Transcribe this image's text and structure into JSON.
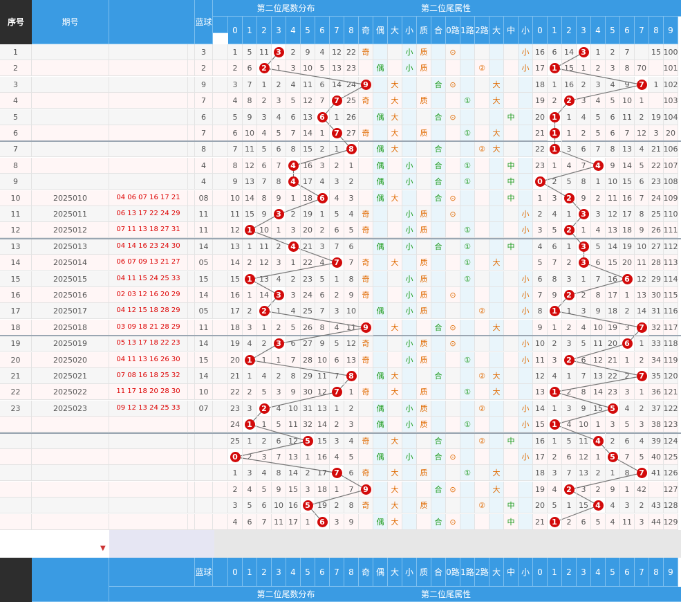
{
  "headers": {
    "seq": "序号",
    "period": "期号",
    "blue_ball": "蓝球",
    "section_digits": "第二位尾数分布",
    "section_attr": "第二位尾属性",
    "digit_labels": [
      "0",
      "1",
      "2",
      "3",
      "4",
      "5",
      "6",
      "7",
      "8",
      "9"
    ],
    "attr_labels": [
      "奇",
      "偶",
      "大",
      "小",
      "质",
      "合",
      "0路",
      "1路",
      "2路",
      "大",
      "中",
      "小"
    ],
    "right_labels": [
      "0",
      "1",
      "2",
      "3",
      "4",
      "5",
      "6",
      "7",
      "8",
      "9"
    ]
  },
  "rows": [
    {
      "seq": "1",
      "period": "",
      "nums": "",
      "blue": "3",
      "digit": 3,
      "miss": [
        "1",
        "5",
        "11",
        "",
        "2",
        "9",
        "4",
        "12",
        "22",
        "3"
      ],
      "oe": "奇",
      "bs": "小",
      "pc": "质",
      "road": "0",
      "size": "小",
      "pos": 3,
      "right": [
        "16",
        "6",
        "14",
        "",
        "1",
        "2",
        "7",
        "",
        "15",
        "100"
      ]
    },
    {
      "seq": "2",
      "period": "",
      "nums": "",
      "blue": "2",
      "digit": 2,
      "miss": [
        "2",
        "6",
        "",
        "1",
        "3",
        "10",
        "5",
        "13",
        "23",
        "4"
      ],
      "oe": "偶",
      "bs": "小",
      "pc": "质",
      "road": "2",
      "size": "小",
      "pos": 1,
      "right": [
        "17",
        "",
        "15",
        "1",
        "2",
        "3",
        "8",
        "70",
        "",
        "101"
      ]
    },
    {
      "seq": "3",
      "period": "",
      "nums": "",
      "blue": "9",
      "digit": 9,
      "miss": [
        "3",
        "7",
        "1",
        "2",
        "4",
        "11",
        "6",
        "14",
        "24",
        ""
      ],
      "oe": "奇",
      "bs": "大",
      "pc": "合",
      "road": "0",
      "size": "大",
      "pos": 7,
      "right": [
        "18",
        "1",
        "16",
        "2",
        "3",
        "4",
        "9",
        "",
        "1",
        "102"
      ]
    },
    {
      "seq": "4",
      "period": "",
      "nums": "",
      "blue": "7",
      "digit": 7,
      "miss": [
        "4",
        "8",
        "2",
        "3",
        "5",
        "12",
        "7",
        "",
        "25",
        "1"
      ],
      "oe": "奇",
      "bs": "大",
      "pc": "质",
      "road": "1",
      "size": "大",
      "pos": 2,
      "right": [
        "19",
        "2",
        "",
        "3",
        "4",
        "5",
        "10",
        "1",
        "",
        "103"
      ]
    },
    {
      "seq": "5",
      "period": "",
      "nums": "",
      "blue": "6",
      "digit": 6,
      "miss": [
        "5",
        "9",
        "3",
        "4",
        "6",
        "13",
        "",
        "1",
        "26",
        "2"
      ],
      "oe": "偶",
      "bs": "大",
      "pc": "合",
      "road": "0",
      "size": "中",
      "pos": 1,
      "right": [
        "20",
        "",
        "1",
        "4",
        "5",
        "6",
        "11",
        "2",
        "19",
        "104"
      ]
    },
    {
      "seq": "6",
      "period": "",
      "nums": "",
      "blue": "7",
      "digit": 7,
      "miss": [
        "6",
        "10",
        "4",
        "5",
        "7",
        "14",
        "1",
        "",
        "27",
        "3"
      ],
      "oe": "奇",
      "bs": "大",
      "pc": "质",
      "road": "1",
      "size": "大",
      "pos": 1,
      "right": [
        "21",
        "",
        "1",
        "2",
        "5",
        "6",
        "7",
        "12",
        "3",
        "20",
        "105"
      ]
    },
    {
      "seq": "7",
      "period": "",
      "nums": "",
      "blue": "8",
      "digit": 8,
      "miss": [
        "7",
        "11",
        "5",
        "6",
        "8",
        "15",
        "2",
        "1",
        "",
        "4"
      ],
      "oe": "偶",
      "bs": "大",
      "pc": "合",
      "road": "2",
      "size": "大",
      "pos": 1,
      "right": [
        "22",
        "",
        "3",
        "6",
        "7",
        "8",
        "13",
        "4",
        "21",
        "106"
      ]
    },
    {
      "seq": "8",
      "period": "",
      "nums": "",
      "blue": "4",
      "digit": 4,
      "miss": [
        "8",
        "12",
        "6",
        "7",
        "",
        "16",
        "3",
        "2",
        "1",
        "5"
      ],
      "oe": "偶",
      "bs": "小",
      "pc": "合",
      "road": "1",
      "size": "中",
      "pos": 4,
      "right": [
        "23",
        "1",
        "4",
        "7",
        "",
        "9",
        "14",
        "5",
        "22",
        "107"
      ]
    },
    {
      "seq": "9",
      "period": "",
      "nums": "",
      "blue": "4",
      "digit": 4,
      "miss": [
        "9",
        "13",
        "7",
        "8",
        "",
        "17",
        "4",
        "3",
        "2",
        "6"
      ],
      "oe": "偶",
      "bs": "小",
      "pc": "合",
      "road": "1",
      "size": "中",
      "pos": 0,
      "right": [
        "",
        "2",
        "5",
        "8",
        "1",
        "10",
        "15",
        "6",
        "23",
        "108"
      ]
    },
    {
      "seq": "10",
      "period": "2025010",
      "nums": "04 06 07 16 17 21",
      "blue": "08",
      "digit": 6,
      "miss": [
        "10",
        "14",
        "8",
        "9",
        "1",
        "18",
        "",
        "4",
        "3",
        "7"
      ],
      "oe": "偶",
      "bs": "大",
      "pc": "合",
      "road": "0",
      "size": "中",
      "pos": 2,
      "right": [
        "1",
        "3",
        "",
        "9",
        "2",
        "11",
        "16",
        "7",
        "24",
        "109"
      ]
    },
    {
      "seq": "11",
      "period": "2025011",
      "nums": "06 13 17 22 24 29",
      "blue": "11",
      "digit": 3,
      "miss": [
        "11",
        "15",
        "9",
        "",
        "2",
        "19",
        "1",
        "5",
        "4",
        "8"
      ],
      "oe": "奇",
      "bs": "小",
      "pc": "质",
      "road": "0",
      "size": "小",
      "pos": 3,
      "right": [
        "2",
        "4",
        "1",
        "",
        "3",
        "12",
        "17",
        "8",
        "25",
        "110"
      ]
    },
    {
      "seq": "12",
      "period": "2025012",
      "nums": "07 11 13 18 27 31",
      "blue": "11",
      "digit": 1,
      "miss": [
        "12",
        "",
        "10",
        "1",
        "3",
        "20",
        "2",
        "6",
        "5",
        "9"
      ],
      "oe": "奇",
      "bs": "小",
      "pc": "质",
      "road": "1",
      "size": "小",
      "pos": 2,
      "right": [
        "3",
        "5",
        "",
        "1",
        "4",
        "13",
        "18",
        "9",
        "26",
        "111"
      ]
    },
    {
      "seq": "13",
      "period": "2025013",
      "nums": "04 14 16 23 24 30",
      "blue": "14",
      "digit": 4,
      "miss": [
        "13",
        "1",
        "11",
        "2",
        "",
        "21",
        "3",
        "7",
        "6",
        "10"
      ],
      "oe": "偶",
      "bs": "小",
      "pc": "合",
      "road": "1",
      "size": "中",
      "pos": 3,
      "right": [
        "4",
        "6",
        "1",
        "",
        "5",
        "14",
        "19",
        "10",
        "27",
        "112"
      ]
    },
    {
      "seq": "14",
      "period": "2025014",
      "nums": "06 07 09 13 21 27",
      "blue": "05",
      "digit": 7,
      "miss": [
        "14",
        "2",
        "12",
        "3",
        "1",
        "22",
        "4",
        "",
        "7",
        "11"
      ],
      "oe": "奇",
      "bs": "大",
      "pc": "质",
      "road": "1",
      "size": "大",
      "pos": 3,
      "right": [
        "5",
        "7",
        "2",
        "",
        "6",
        "15",
        "20",
        "11",
        "28",
        "113"
      ]
    },
    {
      "seq": "15",
      "period": "2025015",
      "nums": "04 11 15 24 25 33",
      "blue": "15",
      "digit": 1,
      "miss": [
        "15",
        "",
        "13",
        "4",
        "2",
        "23",
        "5",
        "1",
        "8",
        "12"
      ],
      "oe": "奇",
      "bs": "小",
      "pc": "质",
      "road": "1",
      "size": "小",
      "pos": 6,
      "right": [
        "6",
        "8",
        "3",
        "1",
        "7",
        "16",
        "",
        "12",
        "29",
        "114"
      ]
    },
    {
      "seq": "16",
      "period": "2025016",
      "nums": "02 03 12 16 20 29",
      "blue": "14",
      "digit": 3,
      "miss": [
        "16",
        "1",
        "14",
        "",
        "3",
        "24",
        "6",
        "2",
        "9",
        "13"
      ],
      "oe": "奇",
      "bs": "小",
      "pc": "质",
      "road": "0",
      "size": "小",
      "pos": 2,
      "right": [
        "7",
        "9",
        "",
        "2",
        "8",
        "17",
        "1",
        "13",
        "30",
        "115"
      ]
    },
    {
      "seq": "17",
      "period": "2025017",
      "nums": "04 12 15 18 28 29",
      "blue": "05",
      "digit": 2,
      "miss": [
        "17",
        "2",
        "",
        "1",
        "4",
        "25",
        "7",
        "3",
        "10",
        "14"
      ],
      "oe": "偶",
      "bs": "小",
      "pc": "质",
      "road": "2",
      "size": "小",
      "pos": 1,
      "right": [
        "8",
        "",
        "1",
        "3",
        "9",
        "18",
        "2",
        "14",
        "31",
        "116"
      ]
    },
    {
      "seq": "18",
      "period": "2025018",
      "nums": "03 09 18 21 28 29",
      "blue": "11",
      "digit": 9,
      "miss": [
        "18",
        "3",
        "1",
        "2",
        "5",
        "26",
        "8",
        "4",
        "11",
        ""
      ],
      "oe": "奇",
      "bs": "大",
      "pc": "合",
      "road": "0",
      "size": "大",
      "pos": 7,
      "right": [
        "9",
        "1",
        "2",
        "4",
        "10",
        "19",
        "3",
        "",
        "32",
        "117"
      ]
    },
    {
      "seq": "19",
      "period": "2025019",
      "nums": "05 13 17 18 22 23",
      "blue": "14",
      "digit": 3,
      "miss": [
        "19",
        "4",
        "2",
        "",
        "6",
        "27",
        "9",
        "5",
        "12",
        "1"
      ],
      "oe": "奇",
      "bs": "小",
      "pc": "质",
      "road": "0",
      "size": "小",
      "pos": 6,
      "right": [
        "10",
        "2",
        "3",
        "5",
        "11",
        "20",
        "",
        "1",
        "33",
        "118"
      ]
    },
    {
      "seq": "20",
      "period": "2025020",
      "nums": "04 11 13 16 26 30",
      "blue": "15",
      "digit": 1,
      "miss": [
        "20",
        "",
        "1",
        "1",
        "7",
        "28",
        "10",
        "6",
        "13",
        "2"
      ],
      "oe": "奇",
      "bs": "小",
      "pc": "质",
      "road": "1",
      "size": "小",
      "pos": 2,
      "right": [
        "11",
        "3",
        "",
        "6",
        "12",
        "21",
        "1",
        "2",
        "34",
        "119"
      ]
    },
    {
      "seq": "21",
      "period": "2025021",
      "nums": "07 08 16 18 25 32",
      "blue": "14",
      "digit": 8,
      "miss": [
        "21",
        "1",
        "4",
        "2",
        "8",
        "29",
        "11",
        "7",
        "",
        "3"
      ],
      "oe": "偶",
      "bs": "大",
      "pc": "合",
      "road": "2",
      "size": "大",
      "pos": 7,
      "right": [
        "12",
        "4",
        "1",
        "7",
        "13",
        "22",
        "2",
        "",
        "35",
        "120"
      ]
    },
    {
      "seq": "22",
      "period": "2025022",
      "nums": "11 17 18 20 28 30",
      "blue": "10",
      "digit": 7,
      "miss": [
        "22",
        "2",
        "5",
        "3",
        "9",
        "30",
        "12",
        "",
        "1",
        "4"
      ],
      "oe": "奇",
      "bs": "大",
      "pc": "质",
      "road": "1",
      "size": "大",
      "pos": 1,
      "right": [
        "13",
        "",
        "2",
        "8",
        "14",
        "23",
        "3",
        "1",
        "36",
        "121"
      ]
    },
    {
      "seq": "23",
      "period": "2025023",
      "nums": "09 12 13 24 25 33",
      "blue": "07",
      "digit": 2,
      "miss": [
        "23",
        "3",
        "",
        "4",
        "10",
        "31",
        "13",
        "1",
        "2",
        "5"
      ],
      "oe": "偶",
      "bs": "小",
      "pc": "质",
      "road": "2",
      "size": "小",
      "pos": 5,
      "right": [
        "14",
        "1",
        "3",
        "9",
        "15",
        "",
        "4",
        "2",
        "37",
        "122"
      ]
    },
    {
      "seq": "",
      "period": "",
      "nums": "",
      "blue": "",
      "digit": 1,
      "miss": [
        "24",
        "",
        "1",
        "5",
        "11",
        "32",
        "14",
        "2",
        "3",
        "6"
      ],
      "oe": "偶",
      "bs": "小",
      "pc": "质",
      "road": "1",
      "size": "小",
      "pos": 1,
      "right": [
        "15",
        "",
        "4",
        "10",
        "1",
        "3",
        "5",
        "3",
        "38",
        "123"
      ]
    },
    {
      "seq": "",
      "period": "",
      "nums": "",
      "blue": "",
      "digit": 5,
      "miss": [
        "25",
        "1",
        "2",
        "6",
        "12",
        "",
        "15",
        "3",
        "4",
        "7"
      ],
      "oe": "奇",
      "bs": "大",
      "pc": "合",
      "road": "2",
      "size": "中",
      "pos": 4,
      "right": [
        "16",
        "1",
        "5",
        "11",
        "",
        "2",
        "6",
        "4",
        "39",
        "124"
      ]
    },
    {
      "seq": "",
      "period": "",
      "nums": "",
      "blue": "",
      "digit": 0,
      "miss": [
        "",
        "2",
        "3",
        "7",
        "13",
        "1",
        "16",
        "4",
        "5",
        "8"
      ],
      "oe": "偶",
      "bs": "小",
      "pc": "合",
      "road": "0",
      "size": "小",
      "pos": 5,
      "right": [
        "17",
        "2",
        "6",
        "12",
        "1",
        "",
        "7",
        "5",
        "40",
        "125"
      ]
    },
    {
      "seq": "",
      "period": "",
      "nums": "",
      "blue": "",
      "digit": 7,
      "miss": [
        "1",
        "3",
        "4",
        "8",
        "14",
        "2",
        "17",
        "",
        "6",
        "9"
      ],
      "oe": "奇",
      "bs": "大",
      "pc": "质",
      "road": "1",
      "size": "大",
      "pos": 7,
      "right": [
        "18",
        "3",
        "7",
        "13",
        "2",
        "1",
        "8",
        "",
        "41",
        "126"
      ]
    },
    {
      "seq": "",
      "period": "",
      "nums": "",
      "blue": "",
      "digit": 9,
      "miss": [
        "2",
        "4",
        "5",
        "9",
        "15",
        "3",
        "18",
        "1",
        "7",
        ""
      ],
      "oe": "奇",
      "bs": "大",
      "pc": "合",
      "road": "0",
      "size": "大",
      "pos": 2,
      "right": [
        "19",
        "4",
        "",
        "3",
        "2",
        "9",
        "1",
        "42",
        "",
        "127"
      ]
    },
    {
      "seq": "",
      "period": "",
      "nums": "",
      "blue": "",
      "digit": 5,
      "miss": [
        "3",
        "5",
        "6",
        "10",
        "16",
        "",
        "19",
        "2",
        "8",
        "1"
      ],
      "oe": "奇",
      "bs": "大",
      "pc": "质",
      "road": "2",
      "size": "中",
      "pos": 4,
      "right": [
        "20",
        "5",
        "1",
        "15",
        "",
        "4",
        "3",
        "2",
        "43",
        "128"
      ]
    },
    {
      "seq": "",
      "period": "",
      "nums": "",
      "blue": "",
      "digit": 6,
      "miss": [
        "4",
        "6",
        "7",
        "11",
        "17",
        "1",
        "",
        "3",
        "9",
        "2"
      ],
      "oe": "偶",
      "bs": "大",
      "pc": "合",
      "road": "0",
      "size": "中",
      "pos": 1,
      "right": [
        "21",
        "",
        "2",
        "6",
        "5",
        "4",
        "11",
        "3",
        "44",
        "129"
      ]
    }
  ]
}
